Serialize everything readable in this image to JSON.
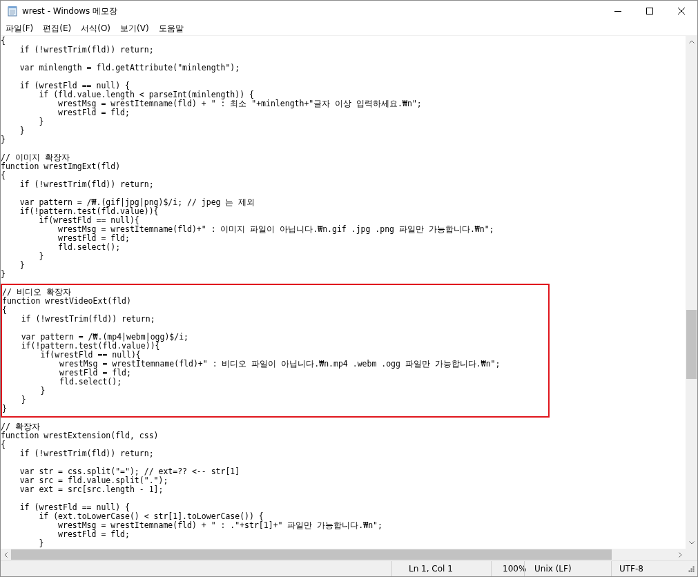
{
  "window": {
    "title": "wrest - Windows 메모장"
  },
  "menu": [
    "파일(F)",
    "편집(E)",
    "서식(O)",
    "보기(V)",
    "도움말"
  ],
  "code_blocks": [
    {
      "highlighted": false,
      "groups": [
        [
          "{",
          "    if (!wrestTrim(fld)) return;"
        ],
        [
          "    var minlength = fld.getAttribute(\"minlength\");"
        ],
        [
          "    if (wrestFld == null) {",
          "        if (fld.value.length < parseInt(minlength)) {",
          "            wrestMsg = wrestItemname(fld) + \" : 최소 \"+minlength+\"글자 이상 입력하세요.₩n\";",
          "            wrestFld = fld;",
          "        }",
          "    }",
          "}"
        ]
      ]
    },
    {
      "highlighted": false,
      "groups": [
        [
          "// 이미지 확장자",
          "function wrestImgExt(fld)",
          "{",
          "    if (!wrestTrim(fld)) return;"
        ],
        [
          "    var pattern = /₩.(gif|jpg|png)$/i; // jpeg 는 제외",
          "    if(!pattern.test(fld.value)){",
          "        if(wrestFld == null){",
          "            wrestMsg = wrestItemname(fld)+\" : 이미지 파일이 아닙니다.₩n.gif .jpg .png 파일만 가능합니다.₩n\";",
          "            wrestFld = fld;",
          "            fld.select();",
          "        }",
          "    }",
          "}"
        ]
      ]
    },
    {
      "highlighted": true,
      "groups": [
        [
          "// 비디오 확장자",
          "function wrestVideoExt(fld)",
          "{",
          "    if (!wrestTrim(fld)) return;"
        ],
        [
          "    var pattern = /₩.(mp4|webm|ogg)$/i;",
          "    if(!pattern.test(fld.value)){",
          "        if(wrestFld == null){",
          "            wrestMsg = wrestItemname(fld)+\" : 비디오 파일이 아닙니다.₩n.mp4 .webm .ogg 파일만 가능합니다.₩n\";",
          "            wrestFld = fld;",
          "            fld.select();",
          "        }",
          "    }",
          "}"
        ]
      ]
    },
    {
      "highlighted": false,
      "groups": [
        [
          "// 확장자",
          "function wrestExtension(fld, css)",
          "{",
          "    if (!wrestTrim(fld)) return;"
        ],
        [
          "    var str = css.split(\"=\"); // ext=?? <-- str[1]",
          "    var src = fld.value.split(\".\");",
          "    var ext = src[src.length - 1];"
        ],
        [
          "    if (wrestFld == null) {",
          "        if (ext.toLowerCase() < str[1].toLowerCase()) {",
          "            wrestMsg = wrestItemname(fld) + \" : .\"+str[1]+\" 파일만 가능합니다.₩n\";",
          "            wrestFld = fld;",
          "        }"
        ]
      ]
    }
  ],
  "status_bar": [
    "Ln 1, Col 1",
    "100%",
    "Unix (LF)",
    "UTF-8"
  ]
}
